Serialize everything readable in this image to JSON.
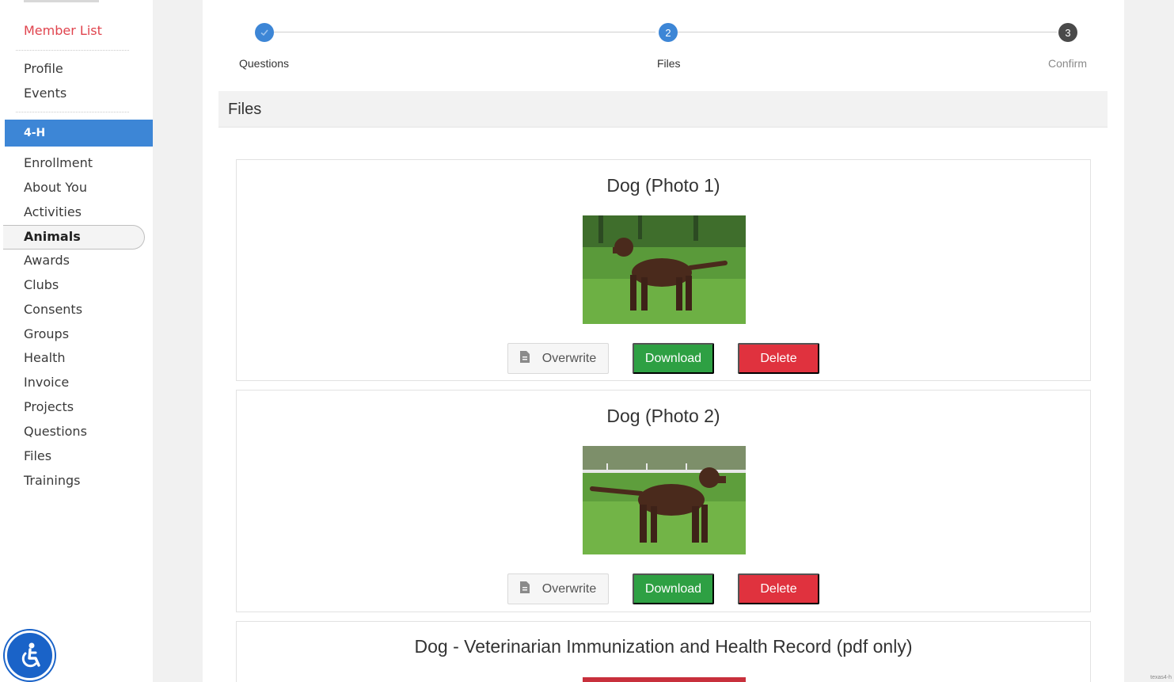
{
  "sidebar": {
    "member_list": "Member List",
    "profile": "Profile",
    "events": "Events",
    "section": "4-H",
    "items": [
      {
        "label": "Enrollment"
      },
      {
        "label": "About You"
      },
      {
        "label": "Activities"
      },
      {
        "label": "Animals",
        "active": true
      },
      {
        "label": "Awards"
      },
      {
        "label": "Clubs"
      },
      {
        "label": "Consents"
      },
      {
        "label": "Groups"
      },
      {
        "label": "Health"
      },
      {
        "label": "Invoice"
      },
      {
        "label": "Projects"
      },
      {
        "label": "Questions"
      },
      {
        "label": "Files"
      },
      {
        "label": "Trainings"
      }
    ]
  },
  "stepper": {
    "steps": [
      {
        "label": "Questions",
        "state": "done",
        "marker": "✓"
      },
      {
        "label": "Files",
        "state": "current",
        "marker": "2"
      },
      {
        "label": "Confirm",
        "state": "todo",
        "marker": "3"
      }
    ]
  },
  "section_title": "Files",
  "files": [
    {
      "title": "Dog (Photo 1)",
      "overwrite": "Overwrite",
      "download": "Download",
      "delete": "Delete"
    },
    {
      "title": "Dog (Photo 2)",
      "overwrite": "Overwrite",
      "download": "Download",
      "delete": "Delete"
    },
    {
      "title": "Dog - Veterinarian Immunization and Health Record (pdf only)"
    }
  ],
  "footer_mark": "texas4-h",
  "colors": {
    "accent": "#3d86d6",
    "danger": "#e0323e",
    "success": "#2ea043",
    "member_link": "#e0444e"
  },
  "icons": {
    "accessibility": "wheelchair-icon",
    "overwrite": "file-icon",
    "check": "check-icon"
  }
}
